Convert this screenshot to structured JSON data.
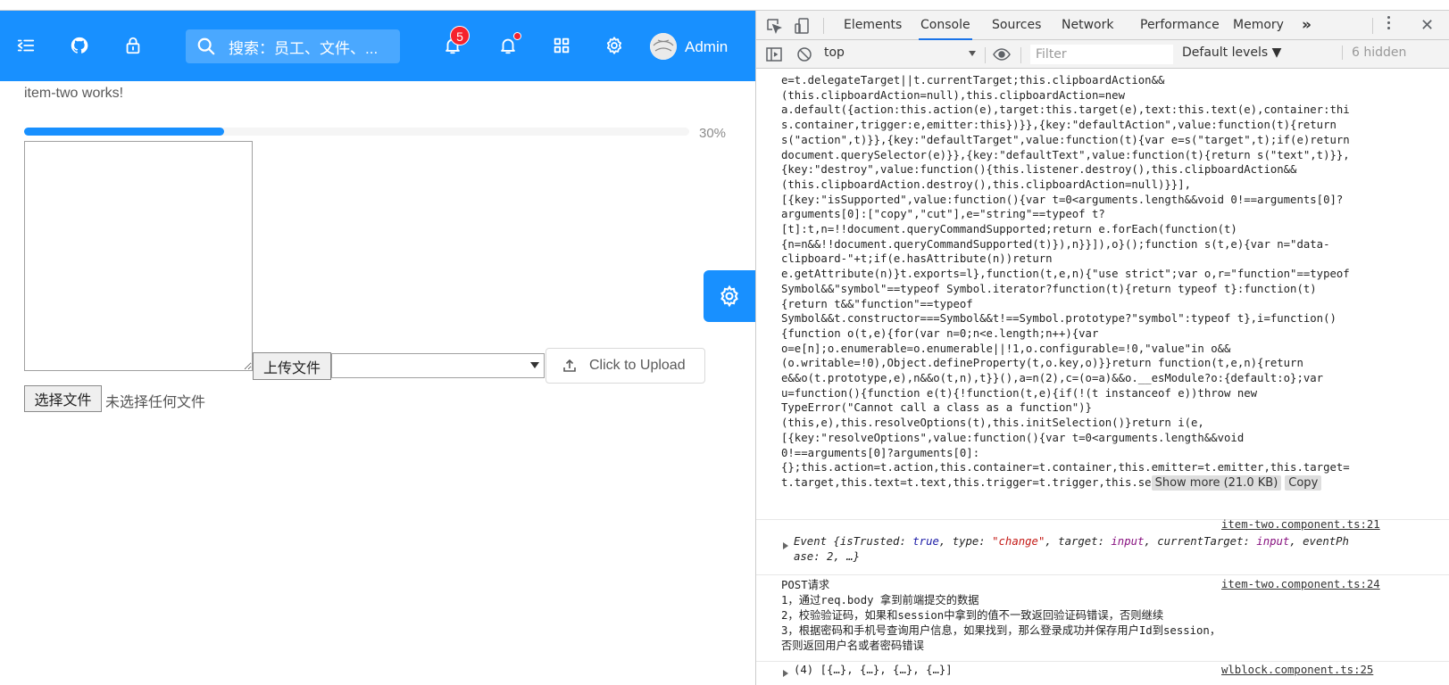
{
  "header": {
    "search_placeholder": "搜索：员工、文件、...",
    "notification_count": "5",
    "user_name": "Admin"
  },
  "content": {
    "works_text": "item-two works!",
    "progress_percent": 30,
    "progress_label": "30%",
    "upload_button": "上传文件",
    "click_upload": "Click to Upload",
    "choose_file": "选择文件",
    "no_file": "未选择任何文件"
  },
  "devtools": {
    "tabs": [
      "Elements",
      "Console",
      "Sources",
      "Network",
      "Performance",
      "Memory"
    ],
    "active_tab": "Console",
    "more_tabs": "»",
    "context": "top",
    "filter_placeholder": "Filter",
    "levels": "Default levels ▼",
    "hidden_count": "6 hidden",
    "code_lines": [
      "e=t.delegateTarget||t.currentTarget;this.clipboardAction&&",
      "(this.clipboardAction=null),this.clipboardAction=new",
      "a.default({action:this.action(e),target:this.target(e),text:this.text(e),container:thi",
      "s.container,trigger:e,emitter:this})}},{key:\"defaultAction\",value:function(t){return",
      "s(\"action\",t)}},{key:\"defaultTarget\",value:function(t){var e=s(\"target\",t);if(e)return",
      "document.querySelector(e)}},{key:\"defaultText\",value:function(t){return s(\"text\",t)}},",
      "{key:\"destroy\",value:function(){this.listener.destroy(),this.clipboardAction&&",
      "(this.clipboardAction.destroy(),this.clipboardAction=null)}}],",
      "[{key:\"isSupported\",value:function(){var t=0<arguments.length&&void 0!==arguments[0]?",
      "arguments[0]:[\"copy\",\"cut\"],e=\"string\"==typeof t?",
      "[t]:t,n=!!document.queryCommandSupported;return e.forEach(function(t)",
      "{n=n&&!!document.queryCommandSupported(t)}),n}}]),o}();function s(t,e){var n=\"data-",
      "clipboard-\"+t;if(e.hasAttribute(n))return",
      "e.getAttribute(n)}t.exports=l},function(t,e,n){\"use strict\";var o,r=\"function\"==typeof",
      "Symbol&&\"symbol\"==typeof Symbol.iterator?function(t){return typeof t}:function(t)",
      "{return t&&\"function\"==typeof",
      "Symbol&&t.constructor===Symbol&&t!==Symbol.prototype?\"symbol\":typeof t},i=function()",
      "{function o(t,e){for(var n=0;n<e.length;n++){var",
      "o=e[n];o.enumerable=o.enumerable||!1,o.configurable=!0,\"value\"in o&&",
      "(o.writable=!0),Object.defineProperty(t,o.key,o)}}return function(t,e,n){return",
      "e&&o(t.prototype,e),n&&o(t,n),t}}(),a=n(2),c=(o=a)&&o.__esModule?o:{default:o};var",
      "u=function(){function e(t){!function(t,e){if(!(t instanceof e))throw new",
      "TypeError(\"Cannot call a class as a function\")}",
      "(this,e),this.resolveOptions(t),this.initSelection()}return i(e,",
      "[{key:\"resolveOptions\",value:function(){var t=0<arguments.length&&void",
      "0!==arguments[0]?arguments[0]:",
      "{};this.action=t.action,this.container=t.container,this.emitter=t.emitter,this.target=",
      "t.target,this.text=t.text,this.trigger=t.trigger,this.se"
    ],
    "show_more": "Show more (21.0 KB)",
    "copy": "Copy",
    "source_1": "item-two.component.ts:21",
    "event_line1_prefix": "Event {isTrusted: ",
    "event_true": "true",
    "event_type_key": ", type: ",
    "event_type_val": "\"change\"",
    "event_target_key": ", target: ",
    "event_target_val": "input",
    "event_ct_key": ", currentTarget: ",
    "event_ct_val": "input",
    "event_ep": ", eventPh",
    "event_line2": "ase: 2, …}",
    "source_2": "item-two.component.ts:24",
    "post_lines": [
      "POST请求",
      "1，通过req.body 拿到前端提交的数据",
      "2，校验验证码，如果和session中拿到的值不一致返回验证码错误，否则继续",
      "3，根据密码和手机号查询用户信息，如果找到，那么登录成功并保存用户Id到session，",
      "否则返回用户名或者密码错误"
    ],
    "last_line": "(4) [{…}, {…}, {…}, {…}]",
    "source_3": "wlblock.component.ts:25"
  }
}
